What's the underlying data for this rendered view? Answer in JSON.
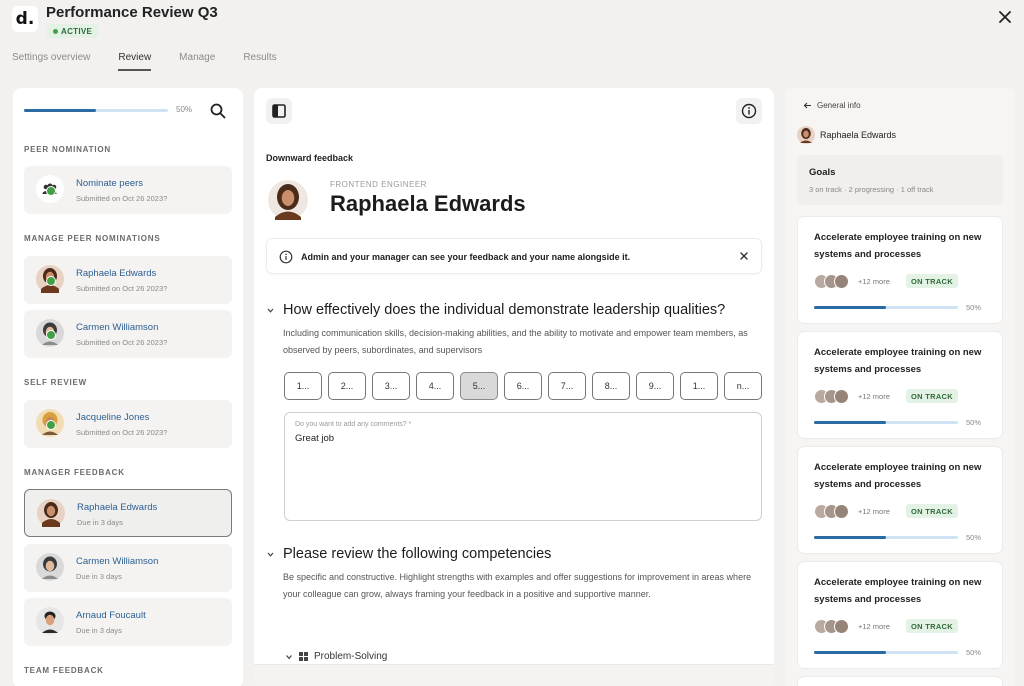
{
  "app": {
    "title": "Performance Review Q3",
    "logo_text": "d.",
    "status": "ACTIVE"
  },
  "tabs": [
    {
      "label": "Settings overview",
      "active": false
    },
    {
      "label": "Review",
      "active": true
    },
    {
      "label": "Manage",
      "active": false
    },
    {
      "label": "Results",
      "active": false
    }
  ],
  "left": {
    "progress": {
      "label": "50%",
      "value": 0.5
    },
    "sections": {
      "peer_nomination": "PEER NOMINATION",
      "manage_peer": "MANAGE PEER NOMINATIONS",
      "self_review": "SELF REVIEW",
      "manager_feedback": "MANAGER FEEDBACK",
      "team_feedback": "TEAM FEEDBACK"
    },
    "cards": [
      {
        "name": "Nominate peers",
        "sub": "Submitted on Oct 26 2023?",
        "avatar": "group-icon",
        "done": true
      },
      {
        "name": "Raphaela Edwards",
        "sub": "Submitted on Oct 26 2023?",
        "avatar": "raphaela",
        "done": true
      },
      {
        "name": "Carmen Williamson",
        "sub": "Submitted on Oct 26 2023?",
        "avatar": "carmen",
        "done": true
      },
      {
        "name": "Jacqueline Jones",
        "sub": "Submitted on Oct 26 2023?",
        "avatar": "jacqueline",
        "done": true
      },
      {
        "name": "Raphaela Edwards",
        "sub": "Due in 3 days",
        "avatar": "raphaela",
        "done": false
      },
      {
        "name": "Carmen Williamson",
        "sub": "Due in 3 days",
        "avatar": "carmen",
        "done": false
      },
      {
        "name": "Arnaud Foucault",
        "sub": "Due in 3 days",
        "avatar": "arnaud",
        "done": false
      }
    ]
  },
  "main": {
    "feedback_type": "Downward feedback",
    "role": "FRONTEND ENGINEER",
    "reviewee": "Raphaela Edwards",
    "notice": "Admin and your manager can see your feedback and your name alongside it.",
    "question1": {
      "title": "How effectively does the individual demonstrate leadership qualities?",
      "description": "Including communication skills, decision-making abilities, and the ability to motivate and empower team members, as observed by peers, subordinates, and supervisors",
      "scale": [
        "1...",
        "2...",
        "3...",
        "4...",
        "5...",
        "6...",
        "7...",
        "8...",
        "9...",
        "1...",
        "n..."
      ],
      "selected_index": 4,
      "comment_label": "Do you want to add any comments? *",
      "comment_value": "Great job"
    },
    "question2": {
      "title": "Please review the following competencies",
      "description": "Be specific and constructive. Highlight strengths with examples and offer suggestions for improvement in areas where your colleague can grow, always framing your feedback in a positive and supportive manner."
    },
    "subsection": "Problem-Solving"
  },
  "right": {
    "back_label": "General info",
    "person": "Raphaela Edwards",
    "goals_title": "Goals",
    "goals_summary": "3 on track · 2 progressing · 1 off track",
    "goals": [
      {
        "title": "Accelerate employee training on new systems and processes",
        "more": "+12 more",
        "status": "ON TRACK",
        "pct": "50%",
        "progress": 0.5
      },
      {
        "title": "Accelerate employee training on new systems and processes",
        "more": "+12 more",
        "status": "ON TRACK",
        "pct": "50%",
        "progress": 0.5
      },
      {
        "title": "Accelerate employee training on new systems and processes",
        "more": "+12 more",
        "status": "ON TRACK",
        "pct": "50%",
        "progress": 0.5
      },
      {
        "title": "Accelerate employee training on new systems and processes",
        "more": "+12 more",
        "status": "ON TRACK",
        "pct": "50%",
        "progress": 0.5
      }
    ]
  },
  "colors": {
    "accent": "#2c6aa3",
    "link": "#2c5f94",
    "success": "#43a047",
    "background": "#f2f1ef"
  }
}
